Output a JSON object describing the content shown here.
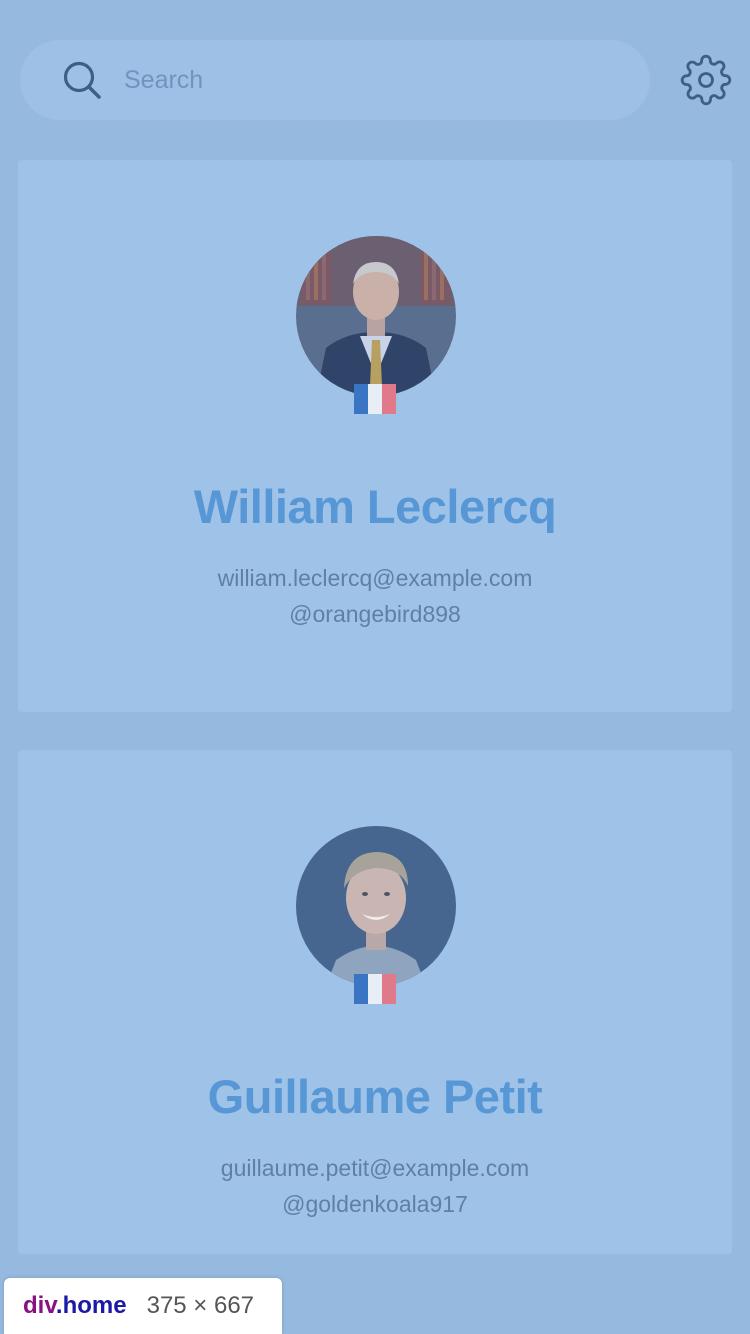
{
  "search": {
    "placeholder": "Search",
    "value": ""
  },
  "users": [
    {
      "name": "William Leclercq",
      "email": "william.leclercq@example.com",
      "handle": "@orangebird898",
      "country_flag": "france-flag"
    },
    {
      "name": "Guillaume Petit",
      "email": "guillaume.petit@example.com",
      "handle": "@goldenkoala917",
      "country_flag": "france-flag"
    }
  ],
  "inspector": {
    "tag": "div",
    "class_name": ".home",
    "size": "375 × 667"
  },
  "colors": {
    "background": "#96b9df",
    "card": "#9fc3e8",
    "name": "#5897d6",
    "muted_text": "#5f80a3",
    "icon": "#3e5f85"
  }
}
